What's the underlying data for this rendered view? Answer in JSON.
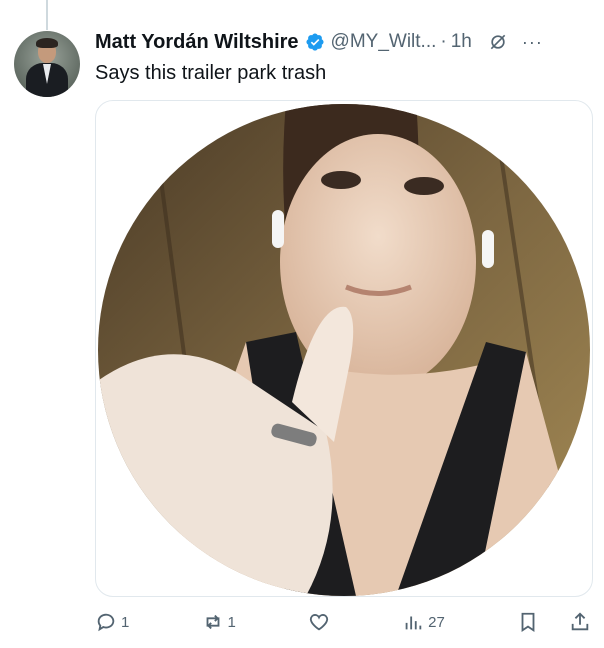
{
  "tweet": {
    "author": {
      "display_name": "Matt Yordán Wiltshire",
      "handle": "@MY_Wilt...",
      "verified": true
    },
    "separator": "·",
    "time": "1h",
    "more": "···",
    "text": "Says this trailer park trash",
    "media_alt": "Circular selfie photo"
  },
  "actions": {
    "reply_count": "1",
    "retweet_count": "1",
    "views_count": "27"
  },
  "colors": {
    "verified_blue": "#1d9bf0",
    "secondary_text": "#536471",
    "primary_text": "#0f1419"
  },
  "icons": [
    "verified-badge-icon",
    "grok-icon",
    "more-icon",
    "reply-icon",
    "retweet-icon",
    "like-icon",
    "views-icon",
    "bookmark-icon",
    "share-icon"
  ]
}
